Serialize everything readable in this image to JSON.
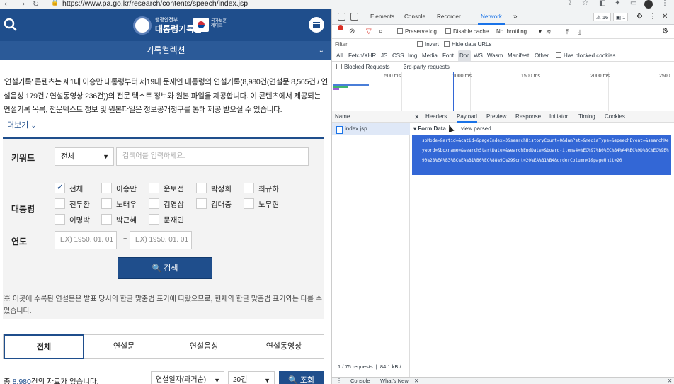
{
  "browser": {
    "url": "https://www.pa.go.kr/research/contents/speech/index.jsp"
  },
  "site": {
    "logo_small": "행정안전부",
    "logo_name": "대통령기록관",
    "logo_sub": "국가보훈 레이크",
    "section": "기록컬렉션",
    "intro": "'연설기록' 콘텐츠는 제1대 이승만 대통령부터 제19대 문재인 대통령의 연설기록(8,980건(연설문 8,565건 / 연설음성 179건 / 연설동영상 236건))의 전문 텍스트 정보와 원본 파일을 제공합니다. 이 콘텐츠에서 제공되는 연설기록 목록, 전문텍스트 정보 및 원본파일은 정보공개청구를 통해 제공 받으실 수 있습니다.",
    "more": "더보기",
    "keyword_label": "키워드",
    "keyword_select": "전체",
    "keyword_placeholder": "검색어를 입력하세요.",
    "president_label": "대통령",
    "presidents": [
      {
        "name": "전체",
        "checked": true
      },
      {
        "name": "이승만",
        "checked": false
      },
      {
        "name": "윤보선",
        "checked": false
      },
      {
        "name": "박정희",
        "checked": false
      },
      {
        "name": "최규하",
        "checked": false
      },
      {
        "name": "전두환",
        "checked": false
      },
      {
        "name": "노태우",
        "checked": false
      },
      {
        "name": "김영삼",
        "checked": false
      },
      {
        "name": "김대중",
        "checked": false
      },
      {
        "name": "노무현",
        "checked": false
      },
      {
        "name": "이명박",
        "checked": false
      },
      {
        "name": "박근혜",
        "checked": false
      },
      {
        "name": "문재인",
        "checked": false
      }
    ],
    "year_label": "연도",
    "date_from": "EX) 1950. 01. 01",
    "date_tilde": "~",
    "date_to": "EX) 1950. 01. 01",
    "search_button": "검색",
    "note": "※ 이곳에 수록된 연설문은 발표 당시의 한글 맞춤법 표기에 따랐으므로, 현재의 한글 맞춤법 표기와는 다를 수 있습니다.",
    "tabs": [
      "전체",
      "연설문",
      "연설음성",
      "연설동영상"
    ],
    "total_prefix": "총 ",
    "total_count": "8,980",
    "total_suffix": "건의 자료가 있습니다.",
    "sort": "연설일자(과거순)",
    "page_size": "20건",
    "lookup_button": "조회"
  },
  "devtools": {
    "tabs": [
      "Elements",
      "Console",
      "Recorder",
      "Network"
    ],
    "active_tab": "Network",
    "warn_count": "16",
    "msg_count": "1",
    "toolbar": {
      "preserve_log": "Preserve log",
      "disable_cache": "Disable cache",
      "throttle": "No throttling"
    },
    "filter_placeholder": "Filter",
    "invert": "Invert",
    "hide_data_urls": "Hide data URLs",
    "types": [
      "All",
      "Fetch/XHR",
      "JS",
      "CSS",
      "Img",
      "Media",
      "Font",
      "Doc",
      "WS",
      "Wasm",
      "Manifest",
      "Other"
    ],
    "active_type": "Doc",
    "blocked_cookies": "Has blocked cookies",
    "blocked_requests": "Blocked Requests",
    "third_party": "3rd-party requests",
    "timeline_ticks": [
      "500 ms",
      "1000 ms",
      "1500 ms",
      "2000 ms",
      "2500"
    ],
    "name_header": "Name",
    "request_name": "index.jsp",
    "detail_tabs": [
      "Headers",
      "Payload",
      "Preview",
      "Response",
      "Initiator",
      "Timing",
      "Cookies"
    ],
    "active_detail": "Payload",
    "form_data": "▾ Form Data",
    "view_parsed": "view parsed",
    "payload": "spMode=&artid=&catid=&pageIndex=3&searchHistoryCount=0&damPst=&mediaType=&speechEvent=&searchKeyword=&boxname=&searchStartDate=&searchEndDate=&board-items4=%EC%97%B0%EC%84%A4%EC%9D%BC%EC%9E%90%28%EA%B3%BC%EA%B1%B0%EC%88%9C%29&cnt=20%EA%B1%B4&orderColumn=1&pageUnit=20",
    "requests": "1 / 75 requests",
    "transferred": "84.1 kB /",
    "console_tabs": [
      "Console",
      "What's New"
    ]
  }
}
